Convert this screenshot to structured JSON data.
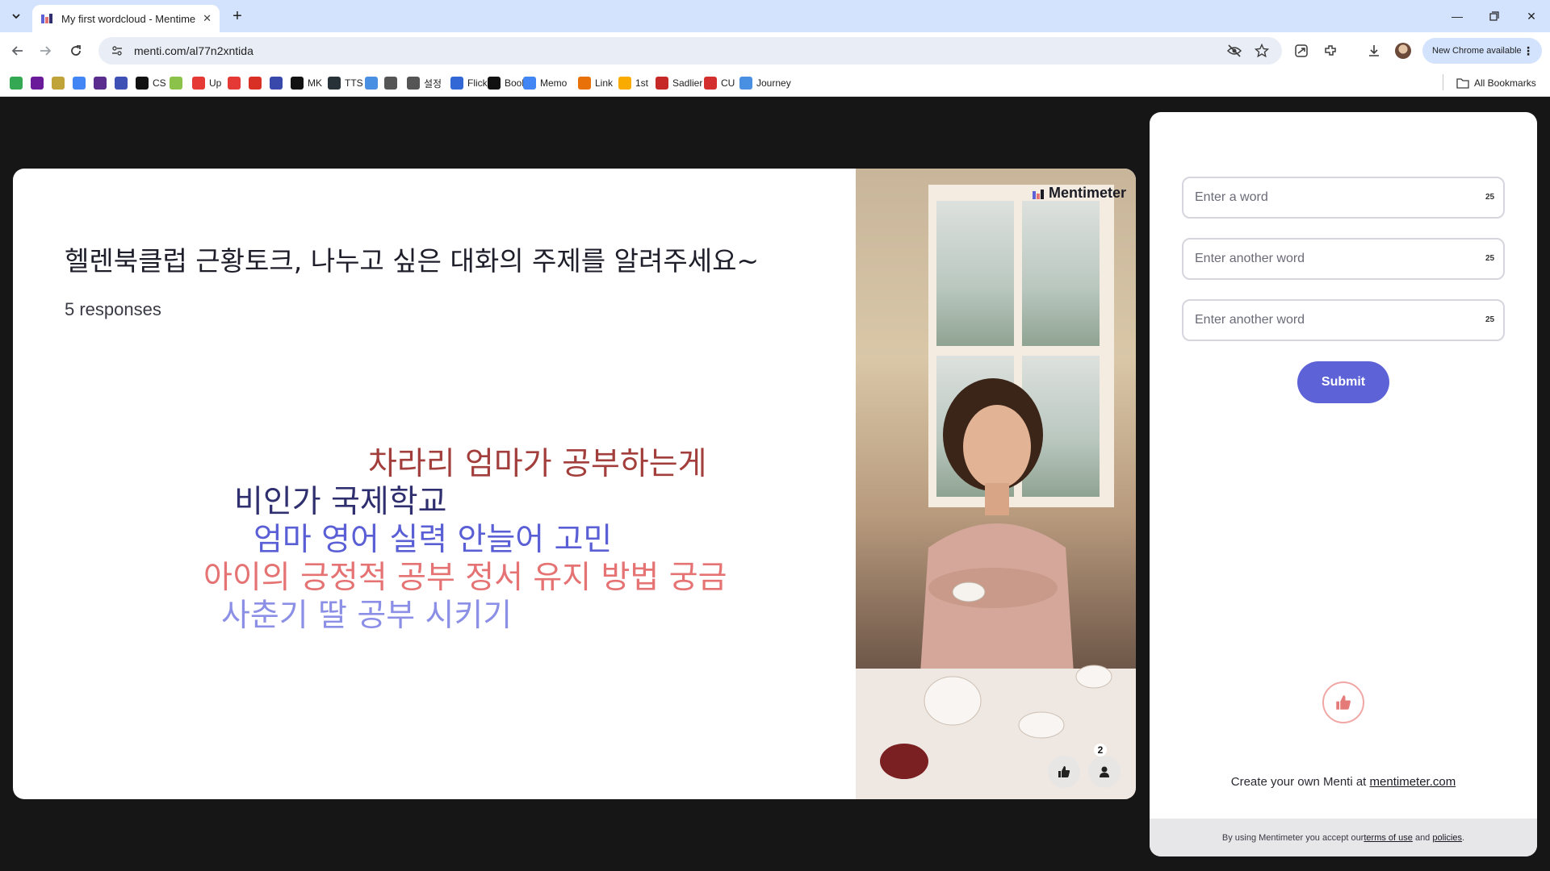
{
  "browser": {
    "tab_title": "My first wordcloud - Mentime",
    "url": "menti.com/al77n2xntida",
    "update_label": "New Chrome available",
    "all_bookmarks_label": "All Bookmarks"
  },
  "bookmarks": [
    {
      "label": "",
      "color": "#34a853"
    },
    {
      "label": "",
      "color": "#6a1b9a"
    },
    {
      "label": "",
      "color": "#c0a43a"
    },
    {
      "label": "",
      "color": "#4285f4"
    },
    {
      "label": "",
      "color": "#5b2d8e"
    },
    {
      "label": "",
      "color": "#3f51b5"
    },
    {
      "label": "CS",
      "color": "#111111"
    },
    {
      "label": "",
      "color": "#8bc34a"
    },
    {
      "label": "Up",
      "color": "#e53935"
    },
    {
      "label": "",
      "color": "#e53935"
    },
    {
      "label": "",
      "color": "#d93025"
    },
    {
      "label": "",
      "color": "#3949ab"
    },
    {
      "label": "MK",
      "color": "#111111"
    },
    {
      "label": "TTS",
      "color": "#263238"
    },
    {
      "label": "",
      "color": "#4a90e2"
    },
    {
      "label": "",
      "color": "#555555"
    },
    {
      "label": "설정",
      "color": "#555555"
    },
    {
      "label": "Flick",
      "color": "#3367d6"
    },
    {
      "label": "Book",
      "color": "#111111"
    },
    {
      "label": "Memo",
      "color": "#4285f4"
    },
    {
      "label": "Link",
      "color": "#e8710a"
    },
    {
      "label": "1st",
      "color": "#f9ab00"
    },
    {
      "label": "Sadlier",
      "color": "#c62828"
    },
    {
      "label": "CU",
      "color": "#d32f2f"
    },
    {
      "label": "Journey",
      "color": "#4a90e2"
    }
  ],
  "slide": {
    "title": "헬렌북클럽 근황토크, 나누고 싶은 대화의 주제를 알려주세요~",
    "responses": "5 responses",
    "brand": "Mentimeter",
    "participants_count": "2"
  },
  "wordcloud": [
    {
      "text": "차라리 엄마가 공부하는게",
      "color": "#a23f3c"
    },
    {
      "text": "비인가 국제학교",
      "color": "#2f2f6f"
    },
    {
      "text": "엄마 영어 실력 안늘어 고민",
      "color": "#5a5fd6"
    },
    {
      "text": "아이의 긍정적 공부 정서 유지 방법 궁금",
      "color": "#e57373"
    },
    {
      "text": "사춘기 딸 공부 시키기",
      "color": "#8c8fe6"
    }
  ],
  "form": {
    "inputs": [
      {
        "placeholder": "Enter a word",
        "value": "",
        "max": "25"
      },
      {
        "placeholder": "Enter another word",
        "value": "",
        "max": "25"
      },
      {
        "placeholder": "Enter another word",
        "value": "",
        "max": "25"
      }
    ],
    "submit_label": "Submit",
    "create_prefix": "Create your own Menti at ",
    "create_link": "mentimeter.com",
    "footer_prefix": "By using Mentimeter you accept our ",
    "terms_link": "terms of use",
    "footer_and": " and ",
    "policies_link": "policies",
    "footer_suffix": "."
  },
  "colors": {
    "accent": "#5d63d6",
    "page_bg": "#161616"
  }
}
